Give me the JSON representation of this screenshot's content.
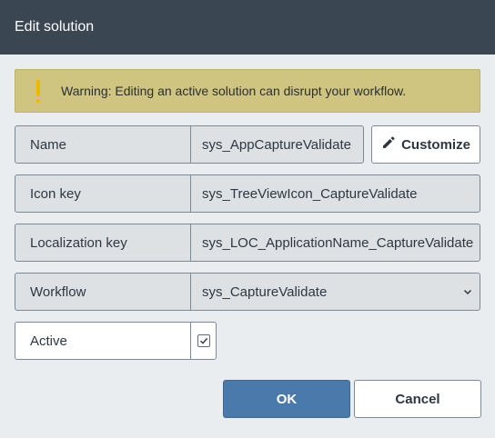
{
  "dialog": {
    "title": "Edit solution"
  },
  "warning": {
    "text": "Warning: Editing an active solution can disrupt your workflow."
  },
  "fields": {
    "name": {
      "label": "Name",
      "value": "sys_AppCaptureValidate"
    },
    "icon_key": {
      "label": "Icon key",
      "value": "sys_TreeViewIcon_CaptureValidate"
    },
    "localization_key": {
      "label": "Localization key",
      "value": "sys_LOC_ApplicationName_CaptureValidate"
    },
    "workflow": {
      "label": "Workflow",
      "value": "sys_CaptureValidate"
    },
    "active": {
      "label": "Active",
      "checked": true
    }
  },
  "buttons": {
    "customize": "Customize",
    "ok": "OK",
    "cancel": "Cancel"
  },
  "colors": {
    "titlebar": "#3a4753",
    "warning_bg": "#cfc581",
    "warning_icon": "#f2b800",
    "primary": "#4a7aab"
  }
}
